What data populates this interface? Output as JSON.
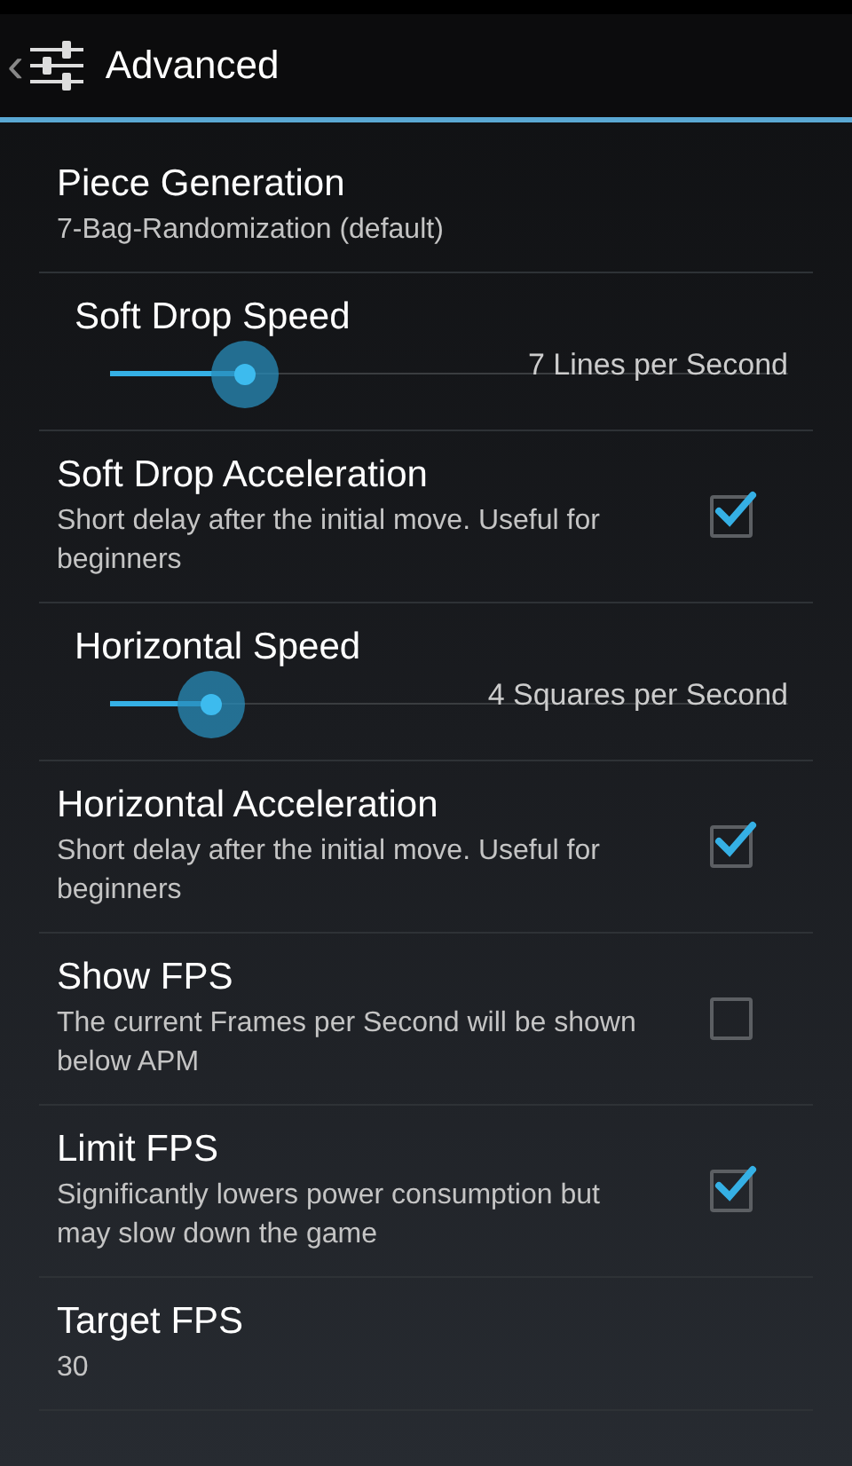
{
  "action_bar": {
    "back": "‹",
    "title": "Advanced"
  },
  "preferences": [
    {
      "kind": "list",
      "title": "Piece Generation",
      "summary": "7-Bag-Randomization (default)"
    },
    {
      "kind": "slider",
      "title": "Soft Drop Speed",
      "level": 0.2,
      "reading": "7 Lines per Second"
    },
    {
      "kind": "checkbox",
      "title": "Soft Drop Acceleration",
      "summary": "Short delay after the initial move. Useful for beginners",
      "checked": true
    },
    {
      "kind": "slider",
      "title": "Horizontal Speed",
      "level": 0.15,
      "reading": "4 Squares per Second"
    },
    {
      "kind": "checkbox",
      "title": "Horizontal Acceleration",
      "summary": "Short delay after the initial move. Useful for beginners",
      "checked": true
    },
    {
      "kind": "checkbox",
      "title": "Show FPS",
      "summary": "The current Frames per Second will be shown below APM",
      "checked": false
    },
    {
      "kind": "checkbox",
      "title": "Limit FPS",
      "summary": "Significantly lowers power consumption but may slow down the game",
      "checked": true
    },
    {
      "kind": "list",
      "title": "Target FPS",
      "summary": "30"
    }
  ]
}
